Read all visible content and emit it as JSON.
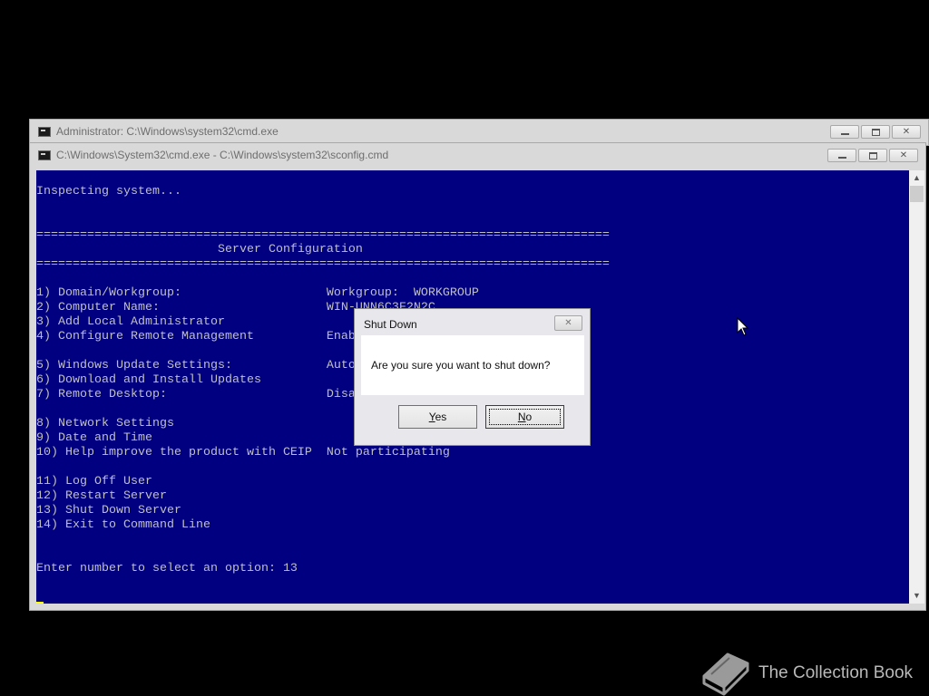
{
  "back_window": {
    "title": "Administrator: C:\\Windows\\system32\\cmd.exe"
  },
  "front_window": {
    "title": "C:\\Windows\\System32\\cmd.exe - C:\\Windows\\system32\\sconfig.cmd"
  },
  "console": {
    "lines": [
      "Inspecting system...",
      "",
      "",
      "===============================================================================",
      "                         Server Configuration",
      "===============================================================================",
      "",
      "1) Domain/Workgroup:                    Workgroup:  WORKGROUP",
      "2) Computer Name:                       WIN-UNN6C3F2N2C",
      "3) Add Local Administrator",
      "4) Configure Remote Management          Enabled",
      "",
      "5) Windows Update Settings:             Automatic",
      "6) Download and Install Updates",
      "7) Remote Desktop:                      Disabled",
      "",
      "8) Network Settings",
      "9) Date and Time",
      "10) Help improve the product with CEIP  Not participating",
      "",
      "11) Log Off User",
      "12) Restart Server",
      "13) Shut Down Server",
      "14) Exit to Command Line",
      "",
      "",
      "Enter number to select an option: 13"
    ]
  },
  "dialog": {
    "title": "Shut Down",
    "message": "Are you sure you want to shut down?",
    "yes_label": "Yes",
    "no_label": "No"
  },
  "watermark": {
    "text": "The Collection Book"
  },
  "icons": [
    "console-icon",
    "minimize-icon",
    "maximize-icon",
    "close-icon",
    "scroll-up-icon",
    "scroll-down-icon",
    "mouse-pointer-icon",
    "book-icon"
  ],
  "colors": {
    "console_bg": "#000080",
    "console_text": "#c0c0c0",
    "desktop": "#000000",
    "cursor": "#ffff00"
  }
}
